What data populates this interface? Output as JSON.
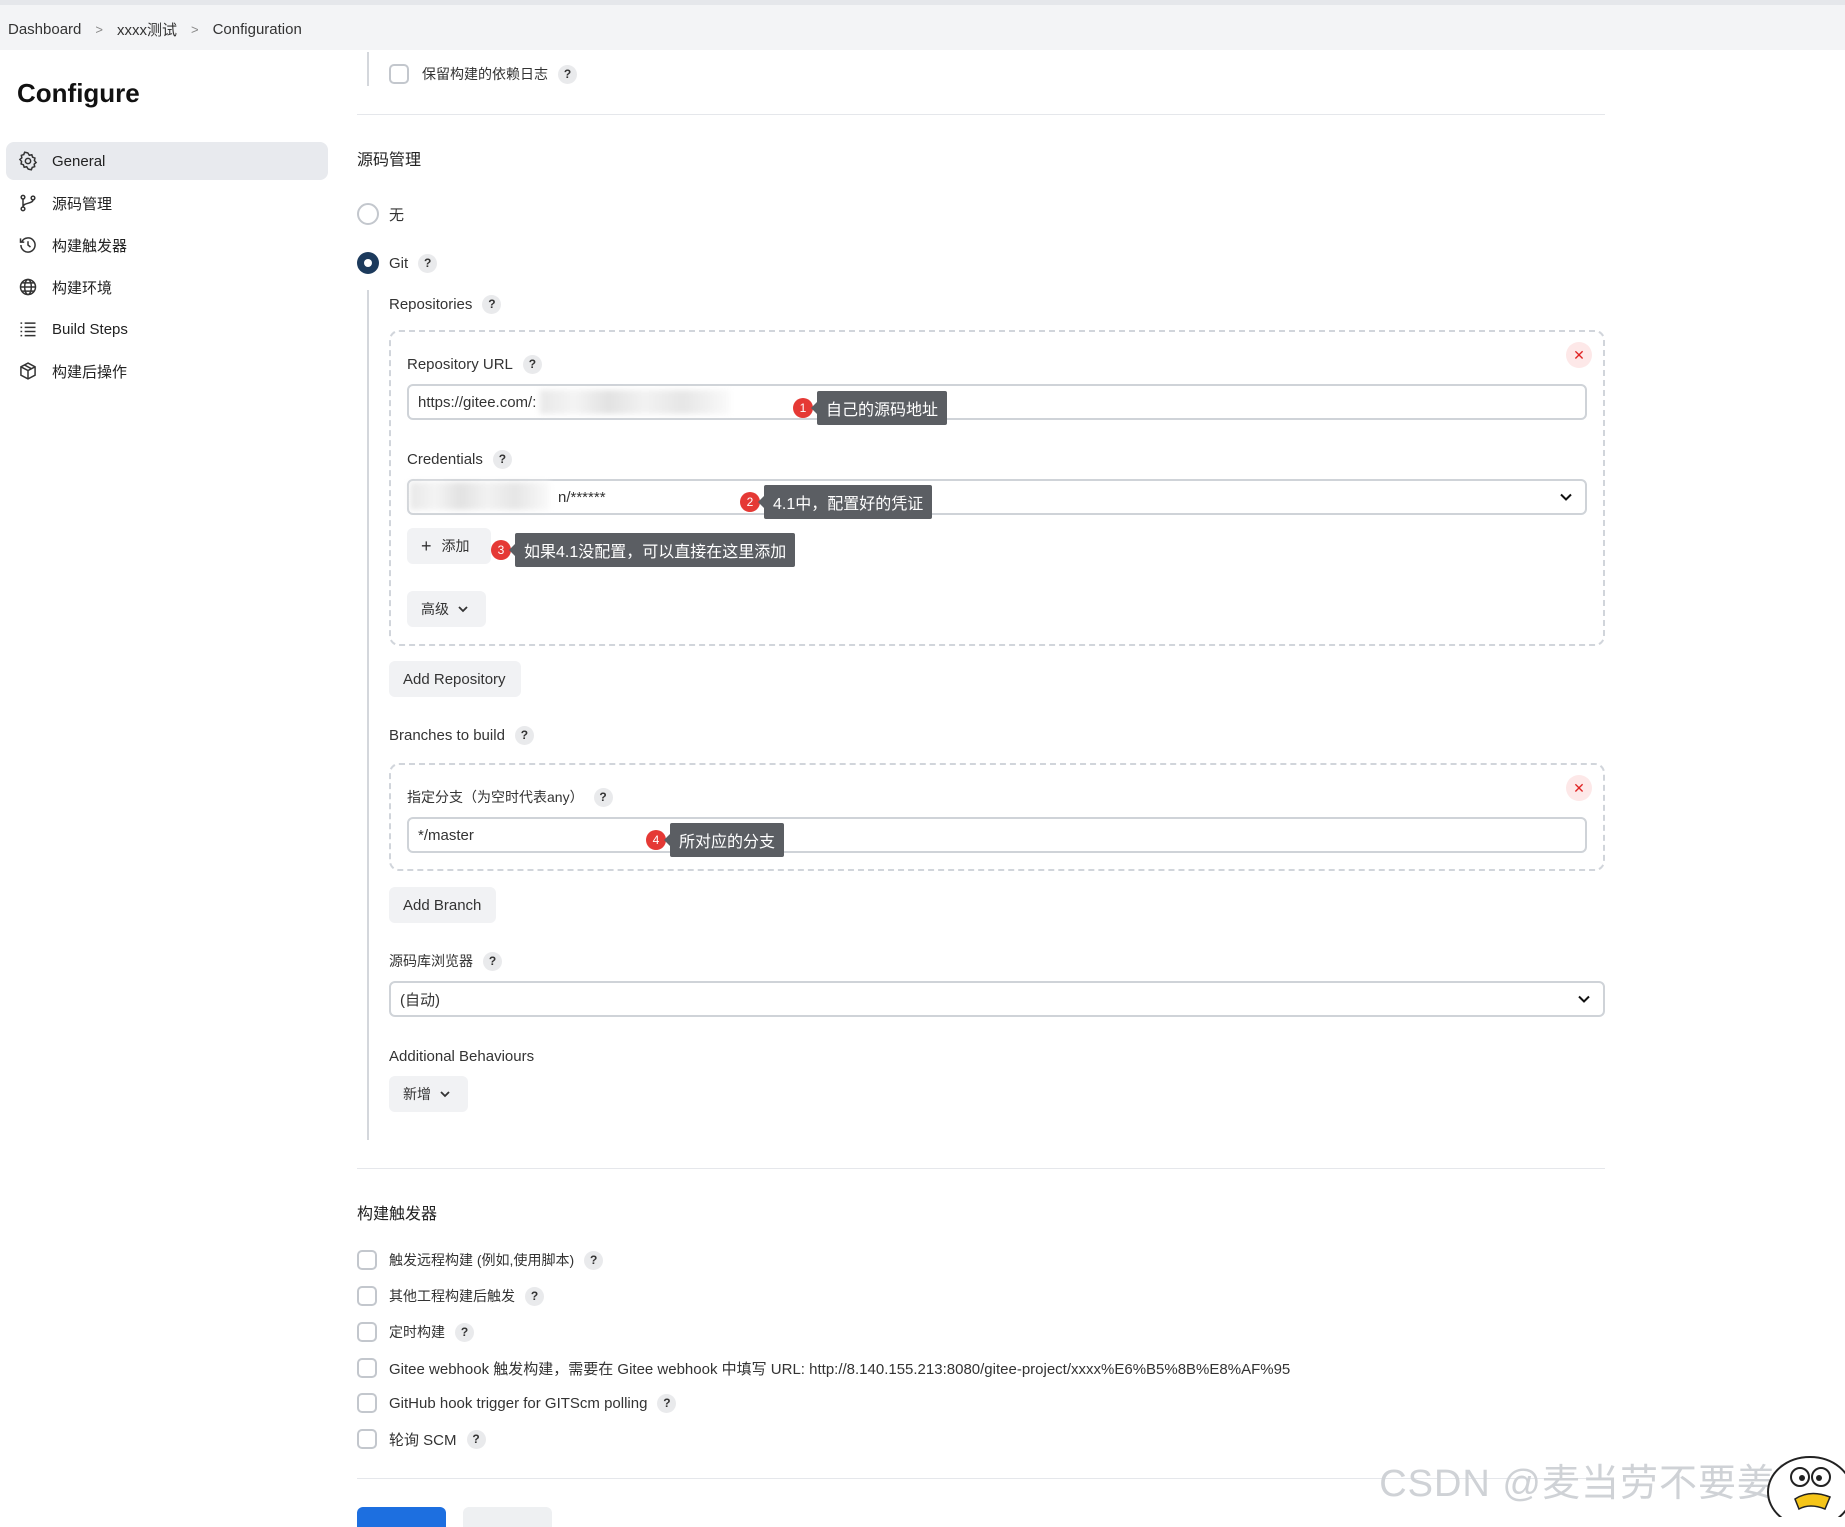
{
  "breadcrumb": {
    "items": [
      "Dashboard",
      "xxxx测试",
      "Configuration"
    ],
    "separator": ">"
  },
  "sidebar": {
    "title": "Configure",
    "items": [
      {
        "label": "General",
        "icon": "gear-icon"
      },
      {
        "label": "源码管理",
        "icon": "git-branch-icon"
      },
      {
        "label": "构建触发器",
        "icon": "clock-icon"
      },
      {
        "label": "构建环境",
        "icon": "globe-icon"
      },
      {
        "label": "Build Steps",
        "icon": "list-icon"
      },
      {
        "label": "构建后操作",
        "icon": "package-icon"
      }
    ]
  },
  "general": {
    "keep_dependency_log_label": "保留构建的依赖日志"
  },
  "scm": {
    "title": "源码管理",
    "option_none": "无",
    "option_git": "Git",
    "repositories_label": "Repositories",
    "repository_url_label": "Repository URL",
    "repository_url_value": "https://gitee.com/:",
    "credentials_label": "Credentials",
    "credentials_value_suffix": "n/******",
    "add_button": "添加",
    "advanced_button": "高级",
    "add_repository_button": "Add Repository",
    "branches_label": "Branches to build",
    "branch_specifier_label": "指定分支（为空时代表any）",
    "branch_value": "*/master",
    "add_branch_button": "Add Branch",
    "repo_browser_label": "源码库浏览器",
    "repo_browser_value": "(自动)",
    "additional_behaviours_label": "Additional Behaviours",
    "add_behaviour_button": "新增",
    "remove_icon": "close-icon",
    "help_glyph": "?"
  },
  "annotations": [
    {
      "num": "1",
      "text": "自己的源码地址"
    },
    {
      "num": "2",
      "text": "4.1中，配置好的凭证"
    },
    {
      "num": "3",
      "text": "如果4.1没配置，可以直接在这里添加"
    },
    {
      "num": "4",
      "text": "所对应的分支"
    }
  ],
  "triggers": {
    "title": "构建触发器",
    "items": [
      {
        "label": "触发远程构建 (例如,使用脚本)",
        "help": true
      },
      {
        "label": "其他工程构建后触发",
        "help": true
      },
      {
        "label": "定时构建",
        "help": true
      },
      {
        "label": "Gitee webhook 触发构建，需要在 Gitee webhook 中填写 URL: http://8.140.155.213:8080/gitee-project/xxxx%E6%B5%8B%E8%AF%95",
        "help": false
      },
      {
        "label": "GitHub hook trigger for GITScm polling",
        "help": true
      },
      {
        "label": "轮询 SCM",
        "help": true
      }
    ]
  },
  "watermark": "CSDN @麦当劳不要姜汁",
  "colors": {
    "accent": "#1c3a5c",
    "annotation_badge": "#e53935",
    "annotation_tip": "#5b5e63",
    "remove_red": "#e02424",
    "primary_button": "#1d6fe0"
  }
}
